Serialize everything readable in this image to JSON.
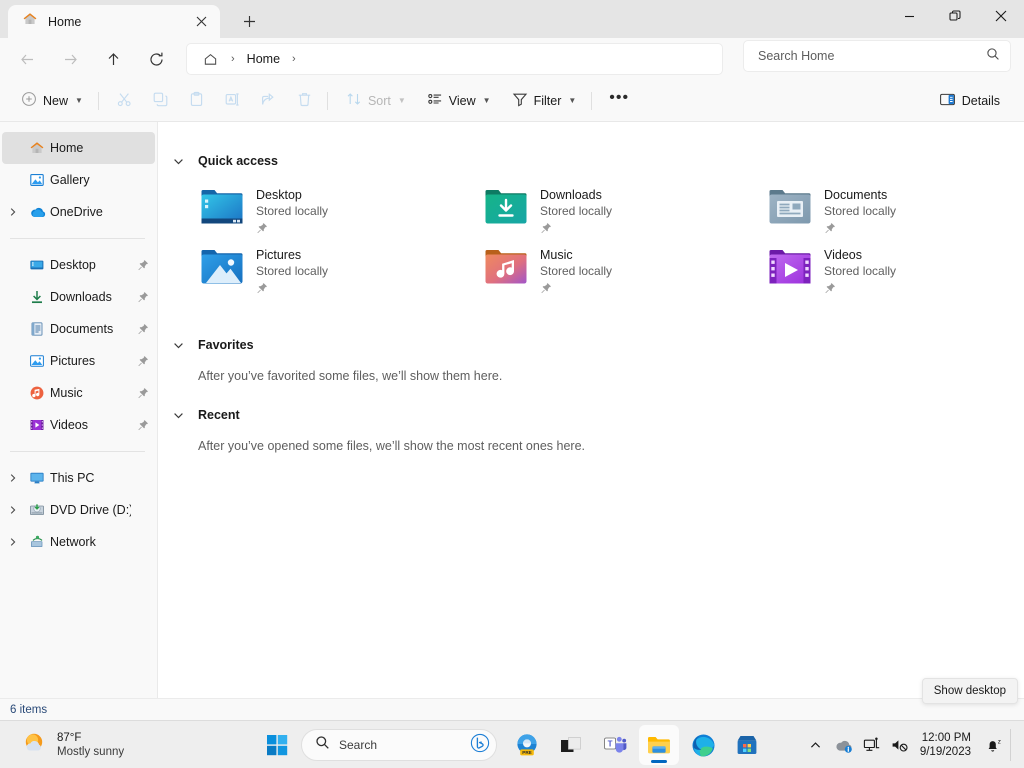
{
  "window": {
    "tab_title": "Home",
    "close_tab_icon": "close-icon",
    "new_tab_icon": "plus-icon",
    "minimize_icon": "minimize-icon",
    "maximize_icon": "restore-icon",
    "close_icon": "close-icon"
  },
  "nav": {
    "back_icon": "arrow-left-icon",
    "forward_icon": "arrow-right-icon",
    "up_icon": "arrow-up-icon",
    "refresh_icon": "refresh-icon",
    "breadcrumb_home_icon": "home-icon",
    "breadcrumb_label": "Home",
    "separator": "›"
  },
  "search": {
    "placeholder": "Search Home",
    "icon": "search-icon"
  },
  "toolbar": {
    "new_label": "New",
    "new_icon": "plus-circle-icon",
    "cut_icon": "scissors-icon",
    "copy_icon": "copy-icon",
    "paste_icon": "clipboard-icon",
    "rename_icon": "rename-icon",
    "share_icon": "share-icon",
    "delete_icon": "trash-icon",
    "sort_label": "Sort",
    "sort_icon": "sort-icon",
    "view_label": "View",
    "view_icon": "view-icon",
    "filter_label": "Filter",
    "filter_icon": "funnel-icon",
    "more_label": "•••",
    "details_label": "Details",
    "details_icon": "details-pane-icon",
    "chevron": "⌄"
  },
  "sidebar": {
    "items": [
      {
        "label": "Home",
        "icon": "home-icon",
        "expander": false,
        "pin": false,
        "selected": true
      },
      {
        "label": "Gallery",
        "icon": "gallery-icon",
        "expander": false,
        "pin": false,
        "selected": false
      },
      {
        "label": "OneDrive",
        "icon": "onedrive-icon",
        "expander": true,
        "pin": false,
        "selected": false
      },
      {
        "divider": true
      },
      {
        "label": "Desktop",
        "icon": "desktop-icon",
        "expander": false,
        "pin": true,
        "selected": false
      },
      {
        "label": "Downloads",
        "icon": "downloads-icon",
        "expander": false,
        "pin": true,
        "selected": false
      },
      {
        "label": "Documents",
        "icon": "documents-icon",
        "expander": false,
        "pin": true,
        "selected": false
      },
      {
        "label": "Pictures",
        "icon": "pictures-icon",
        "expander": false,
        "pin": true,
        "selected": false
      },
      {
        "label": "Music",
        "icon": "music-icon",
        "expander": false,
        "pin": true,
        "selected": false
      },
      {
        "label": "Videos",
        "icon": "videos-icon",
        "expander": false,
        "pin": true,
        "selected": false
      },
      {
        "divider": true
      },
      {
        "label": "This PC",
        "icon": "thispc-icon",
        "expander": true,
        "pin": false,
        "selected": false
      },
      {
        "label": "DVD Drive (D:) CCC",
        "icon": "dvd-icon",
        "expander": true,
        "pin": false,
        "selected": false
      },
      {
        "label": "Network",
        "icon": "network-icon",
        "expander": true,
        "pin": false,
        "selected": false
      }
    ],
    "expander_glyph": "›",
    "pin_glyph": "📌"
  },
  "main": {
    "sections": [
      {
        "id": "quick_access",
        "title": "Quick access"
      },
      {
        "id": "favorites",
        "title": "Favorites",
        "empty_text": "After you’ve favorited some files, we’ll show them here."
      },
      {
        "id": "recent",
        "title": "Recent",
        "empty_text": "After you’ve opened some files, we’ll show the most recent ones here."
      }
    ],
    "chevron_glyph": "⌄",
    "quick_access_items": [
      {
        "name": "Desktop",
        "status": "Stored locally",
        "icon": "desktop-folder-icon",
        "pinned": true
      },
      {
        "name": "Downloads",
        "status": "Stored locally",
        "icon": "downloads-folder-icon",
        "pinned": true
      },
      {
        "name": "Documents",
        "status": "Stored locally",
        "icon": "documents-folder-icon",
        "pinned": true
      },
      {
        "name": "Pictures",
        "status": "Stored locally",
        "icon": "pictures-folder-icon",
        "pinned": true
      },
      {
        "name": "Music",
        "status": "Stored locally",
        "icon": "music-folder-icon",
        "pinned": true
      },
      {
        "name": "Videos",
        "status": "Stored locally",
        "icon": "videos-folder-icon",
        "pinned": true
      }
    ]
  },
  "status": {
    "items_count": "6 items",
    "show_desktop_tooltip": "Show desktop"
  },
  "taskbar": {
    "weather_temp": "87°F",
    "weather_desc": "Mostly sunny",
    "weather_icon": "sun-cloud-icon",
    "start_icon": "windows-start-icon",
    "search_placeholder": "Search",
    "search_icon": "search-icon",
    "bing_icon": "bing-chat-icon",
    "apps": [
      {
        "name": "copilot-preview-icon",
        "label": "PRE"
      },
      {
        "name": "task-view-icon",
        "label": ""
      },
      {
        "name": "microsoft-teams-icon",
        "label": ""
      },
      {
        "name": "file-explorer-icon",
        "label": "",
        "active": true
      },
      {
        "name": "microsoft-edge-icon",
        "label": ""
      },
      {
        "name": "microsoft-store-icon",
        "label": ""
      }
    ],
    "tray": [
      {
        "name": "show-hidden-icons-chevron-icon"
      },
      {
        "name": "onedrive-tray-icon"
      },
      {
        "name": "network-tray-icon"
      },
      {
        "name": "volume-muted-tray-icon"
      }
    ],
    "clock_time": "12:00 PM",
    "clock_date": "9/19/2023",
    "notification_icon": "notification-bell-dnd-icon"
  },
  "colors": {
    "accent": "#0067c0",
    "titlebar_bg": "#e5e5e5",
    "chrome_bg": "#f9f9f9",
    "content_bg": "#ffffff",
    "selection_bg": "#e0e0e0",
    "taskbar_bg": "#eeeeee",
    "status_link": "#2a4a78"
  }
}
